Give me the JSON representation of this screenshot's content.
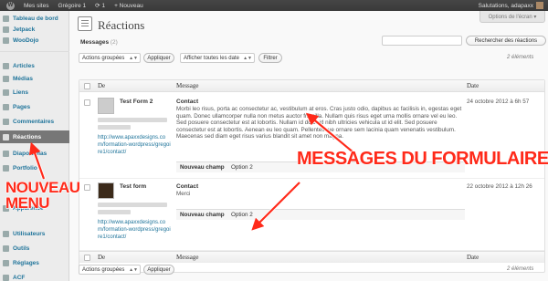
{
  "adminbar": {
    "sites": "Mes sites",
    "site_name": "Grégoire 1",
    "updates": "1",
    "new": "Nouveau",
    "greeting": "Salutations, adapaxx"
  },
  "sidebar": {
    "items": [
      {
        "label": "Tableau de bord",
        "icon": "dashboard-icon"
      },
      {
        "label": "Jetpack",
        "icon": "jetpack-icon"
      },
      {
        "label": "WooDojo",
        "icon": "woodojo-icon"
      },
      {
        "label": "Articles",
        "icon": "pin-icon"
      },
      {
        "label": "Médias",
        "icon": "media-icon"
      },
      {
        "label": "Liens",
        "icon": "link-icon"
      },
      {
        "label": "Pages",
        "icon": "page-icon"
      },
      {
        "label": "Commentaires",
        "icon": "comments-icon"
      },
      {
        "label": "Réactions",
        "icon": "reactions-icon"
      },
      {
        "label": "Diaporamas",
        "icon": "slideshow-icon"
      },
      {
        "label": "Portfolio",
        "icon": "portfolio-icon"
      },
      {
        "label": "Apparence",
        "icon": "appearance-icon"
      },
      {
        "label": "Utilisateurs",
        "icon": "users-icon"
      },
      {
        "label": "Outils",
        "icon": "tools-icon"
      },
      {
        "label": "Réglages",
        "icon": "settings-icon"
      },
      {
        "label": "ACF",
        "icon": "acf-icon"
      }
    ]
  },
  "page": {
    "title": "Réactions",
    "screen_options": "Options de l'écran ▾",
    "messages_label": "Messages",
    "messages_count": "(2)",
    "search_button": "Rechercher des réactions",
    "bulk_actions": "Actions groupées",
    "apply": "Appliquer",
    "date_filter": "Afficher toutes les date",
    "filter": "Filtrer",
    "items_count": "2 éléments"
  },
  "table": {
    "columns": {
      "from": "De",
      "message": "Message",
      "date": "Date"
    },
    "rows": [
      {
        "author": "Test Form 2",
        "link": "http://www.apaxxdesigns.com/formation-wordpress/gregoire1/contact/",
        "subject": "Contact",
        "body": "Morbi leo risus, porta ac consectetur ac, vestibulum at eros. Cras justo odio, dapibus ac facilisis in, egestas eget quam. Donec ullamcorper nulla non metus auctor fringilla. Nullam quis risus eget urna mollis ornare vel eu leo. Sed posuere consectetur est at lobortis. Nullam id dolor id nibh ultricies vehicula ut id elit. Sed posuere consectetur est at lobortis. Aenean eu leo quam. Pellentesque ornare sem lacinia quam venenatis vestibulum. Maecenas sed diam eget risus varius blandit sit amet non magna.",
        "field_name": "Nouveau champ",
        "field_value": "Option 2",
        "date": "24 octobre 2012 à 6h 57"
      },
      {
        "author": "Test form",
        "link": "http://www.apaxxdesigns.com/formation-wordpress/gregoire1/contact/",
        "subject": "Contact",
        "body": "Merci",
        "field_name": "Nouveau champ",
        "field_value": "Option 2",
        "date": "22 octobre 2012 à 12h 26"
      }
    ]
  },
  "annotations": {
    "messages": "MESSAGES DU FORMULAIRE",
    "menu_line1": "NOUVEAU",
    "menu_line2": "MENU",
    "color": "#ff2a1a"
  }
}
